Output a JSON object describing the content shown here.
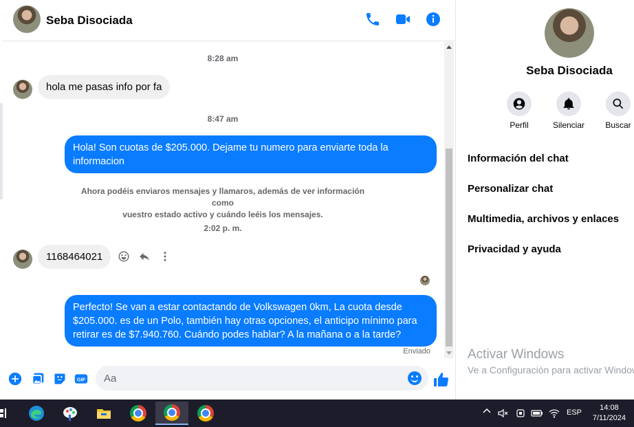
{
  "chat": {
    "contact_name": "Seba Disociada",
    "messages": [
      {
        "type": "timestamp",
        "text": "8:28 am"
      },
      {
        "type": "incoming",
        "text": "hola me pasas info por fa"
      },
      {
        "type": "timestamp",
        "text": "8:47 am"
      },
      {
        "type": "outgoing",
        "line1": "Hola! Son cuotas de $205.000. Dejame tu numero para enviarte toda la",
        "line2": "informacion"
      },
      {
        "type": "notice",
        "line1": "Ahora podéis enviaros mensajes y llamaros, además de ver información como",
        "line2": "vuestro estado activo y cuándo leéis los mensajes."
      },
      {
        "type": "timestamp",
        "text": "2:02 p. m."
      },
      {
        "type": "incoming",
        "text": "1168464021"
      },
      {
        "type": "outgoing",
        "line1": "Perfecto!  Se van a estar contactando de Volkswagen 0km, La cuota desde",
        "line2": "$205.000. es de un Polo, también hay otras opciones, el anticipo mínimo para",
        "line3": "retirar es de $7.940.760. Cuándo podes hablar? A la mañana o a la tarde?"
      }
    ],
    "status": "Enviado",
    "composer_placeholder": "Aa"
  },
  "info_panel": {
    "name": "Seba Disociada",
    "buttons": [
      "Perfil",
      "Silenciar",
      "Buscar"
    ],
    "menu": [
      "Información del chat",
      "Personalizar chat",
      "Multimedia, archivos y enlaces",
      "Privacidad y ayuda"
    ]
  },
  "watermark": {
    "line1": "Activar Windows",
    "line2": "Ve a Configuración para activar Windows."
  },
  "taskbar": {
    "language": "ESP",
    "time": "14:08",
    "date": "7/11/2024"
  },
  "colors": {
    "accent": "#0a7cff",
    "incoming_bubble": "#f0f0f0",
    "taskbar": "#1c1c2a"
  }
}
